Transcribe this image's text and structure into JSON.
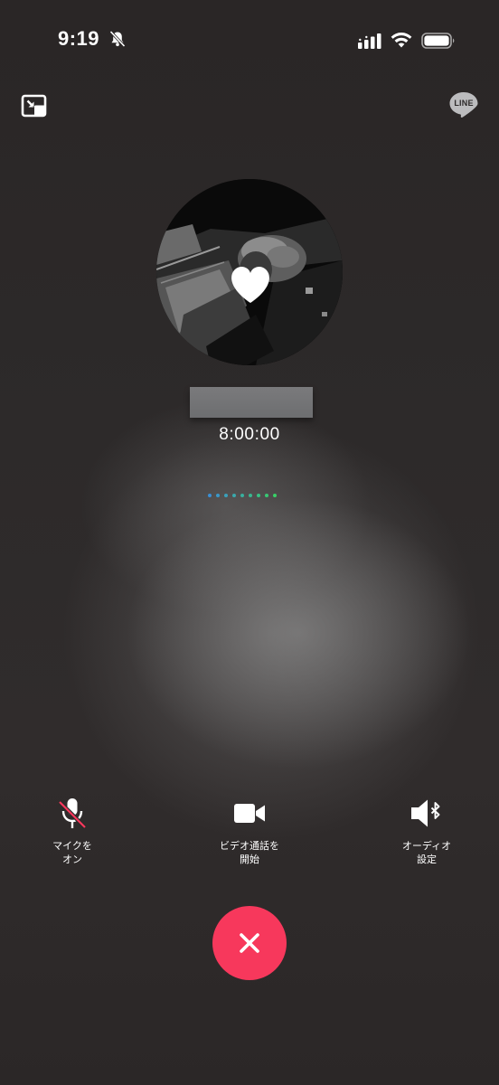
{
  "status_bar": {
    "time": "9:19",
    "icons": [
      "silent-bell-icon",
      "cellular-signal-icon",
      "wifi-icon",
      "battery-icon"
    ]
  },
  "top_controls": {
    "minimize_icon": "minimize-window-icon",
    "app_logo_text": "LINE"
  },
  "call": {
    "contact_name": "",
    "timer": "8:00:00",
    "connecting_dot_colors": [
      "#3a8fd6",
      "#3a98c8",
      "#3aa0ba",
      "#3aa8ac",
      "#39b09e",
      "#39b890",
      "#38c082",
      "#38c874",
      "#38d066"
    ]
  },
  "controls": [
    {
      "id": "mic",
      "label": "マイクを\nオン",
      "icon": "microphone-muted-icon"
    },
    {
      "id": "video",
      "label": "ビデオ通話を\n開始",
      "icon": "video-camera-icon"
    },
    {
      "id": "audio",
      "label": "オーディオ\n設定",
      "icon": "speaker-bluetooth-icon"
    }
  ],
  "end_call": {
    "icon": "close-icon",
    "color": "#f7385c"
  }
}
